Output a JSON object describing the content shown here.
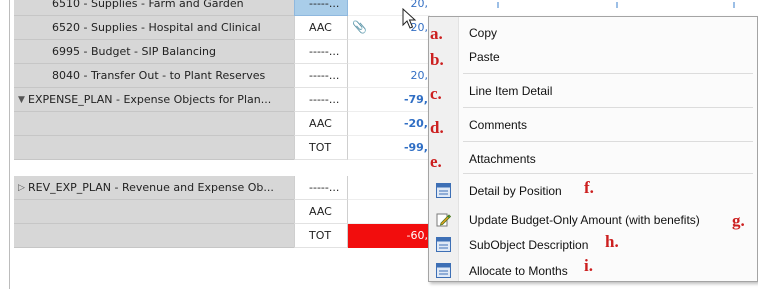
{
  "grid": {
    "rows": [
      {
        "label": "6510 - Supplies - Farm and Garden",
        "code": "-----...",
        "value": "20,"
      },
      {
        "label": "6520 - Supplies - Hospital and Clinical",
        "code": "AAC",
        "value": "20,"
      },
      {
        "label": "6995 - Budget - SIP Balancing",
        "code": "-----...",
        "value": ""
      },
      {
        "label": "8040 - Transfer Out - to Plant Reserves",
        "code": "-----...",
        "value": "20,"
      },
      {
        "label": "EXPENSE_PLAN - Expense Objects for Plan...",
        "code": "-----...",
        "value": "-79,"
      },
      {
        "label": "",
        "code": "AAC",
        "value": "-20,"
      },
      {
        "label": "",
        "code": "TOT",
        "value": "-99,"
      },
      {
        "label": "REV_EXP_PLAN - Revenue and Expense Ob...",
        "code": "-----...",
        "value": ""
      },
      {
        "label": "",
        "code": "AAC",
        "value": ""
      },
      {
        "label": "",
        "code": "TOT",
        "value": "-60,"
      }
    ]
  },
  "context_menu": {
    "items": [
      {
        "label": "Copy",
        "letter": "a.",
        "icon": ""
      },
      {
        "label": "Paste",
        "letter": "b.",
        "icon": ""
      },
      {
        "label": "Line Item Detail",
        "letter": "c.",
        "icon": ""
      },
      {
        "label": "Comments",
        "letter": "d.",
        "icon": ""
      },
      {
        "label": "Attachments",
        "letter": "e.",
        "icon": ""
      },
      {
        "label": "Detail by Position",
        "letter": "f.",
        "icon": "grid-report-icon"
      },
      {
        "label": "Update Budget-Only Amount (with benefits)",
        "letter": "g.",
        "icon": "pencil-edit-icon"
      },
      {
        "label": "SubObject Description",
        "letter": "h.",
        "icon": "grid-report-icon"
      },
      {
        "label": "Allocate to Months",
        "letter": "i.",
        "icon": "grid-report-icon"
      }
    ]
  },
  "colors": {
    "label_bg": "#d7d7d7",
    "value_text": "#3570c4",
    "negative_total_bg": "#f20d0d",
    "selected_cell": "#a9cde9",
    "annotation_letter": "#cc1f1f"
  }
}
